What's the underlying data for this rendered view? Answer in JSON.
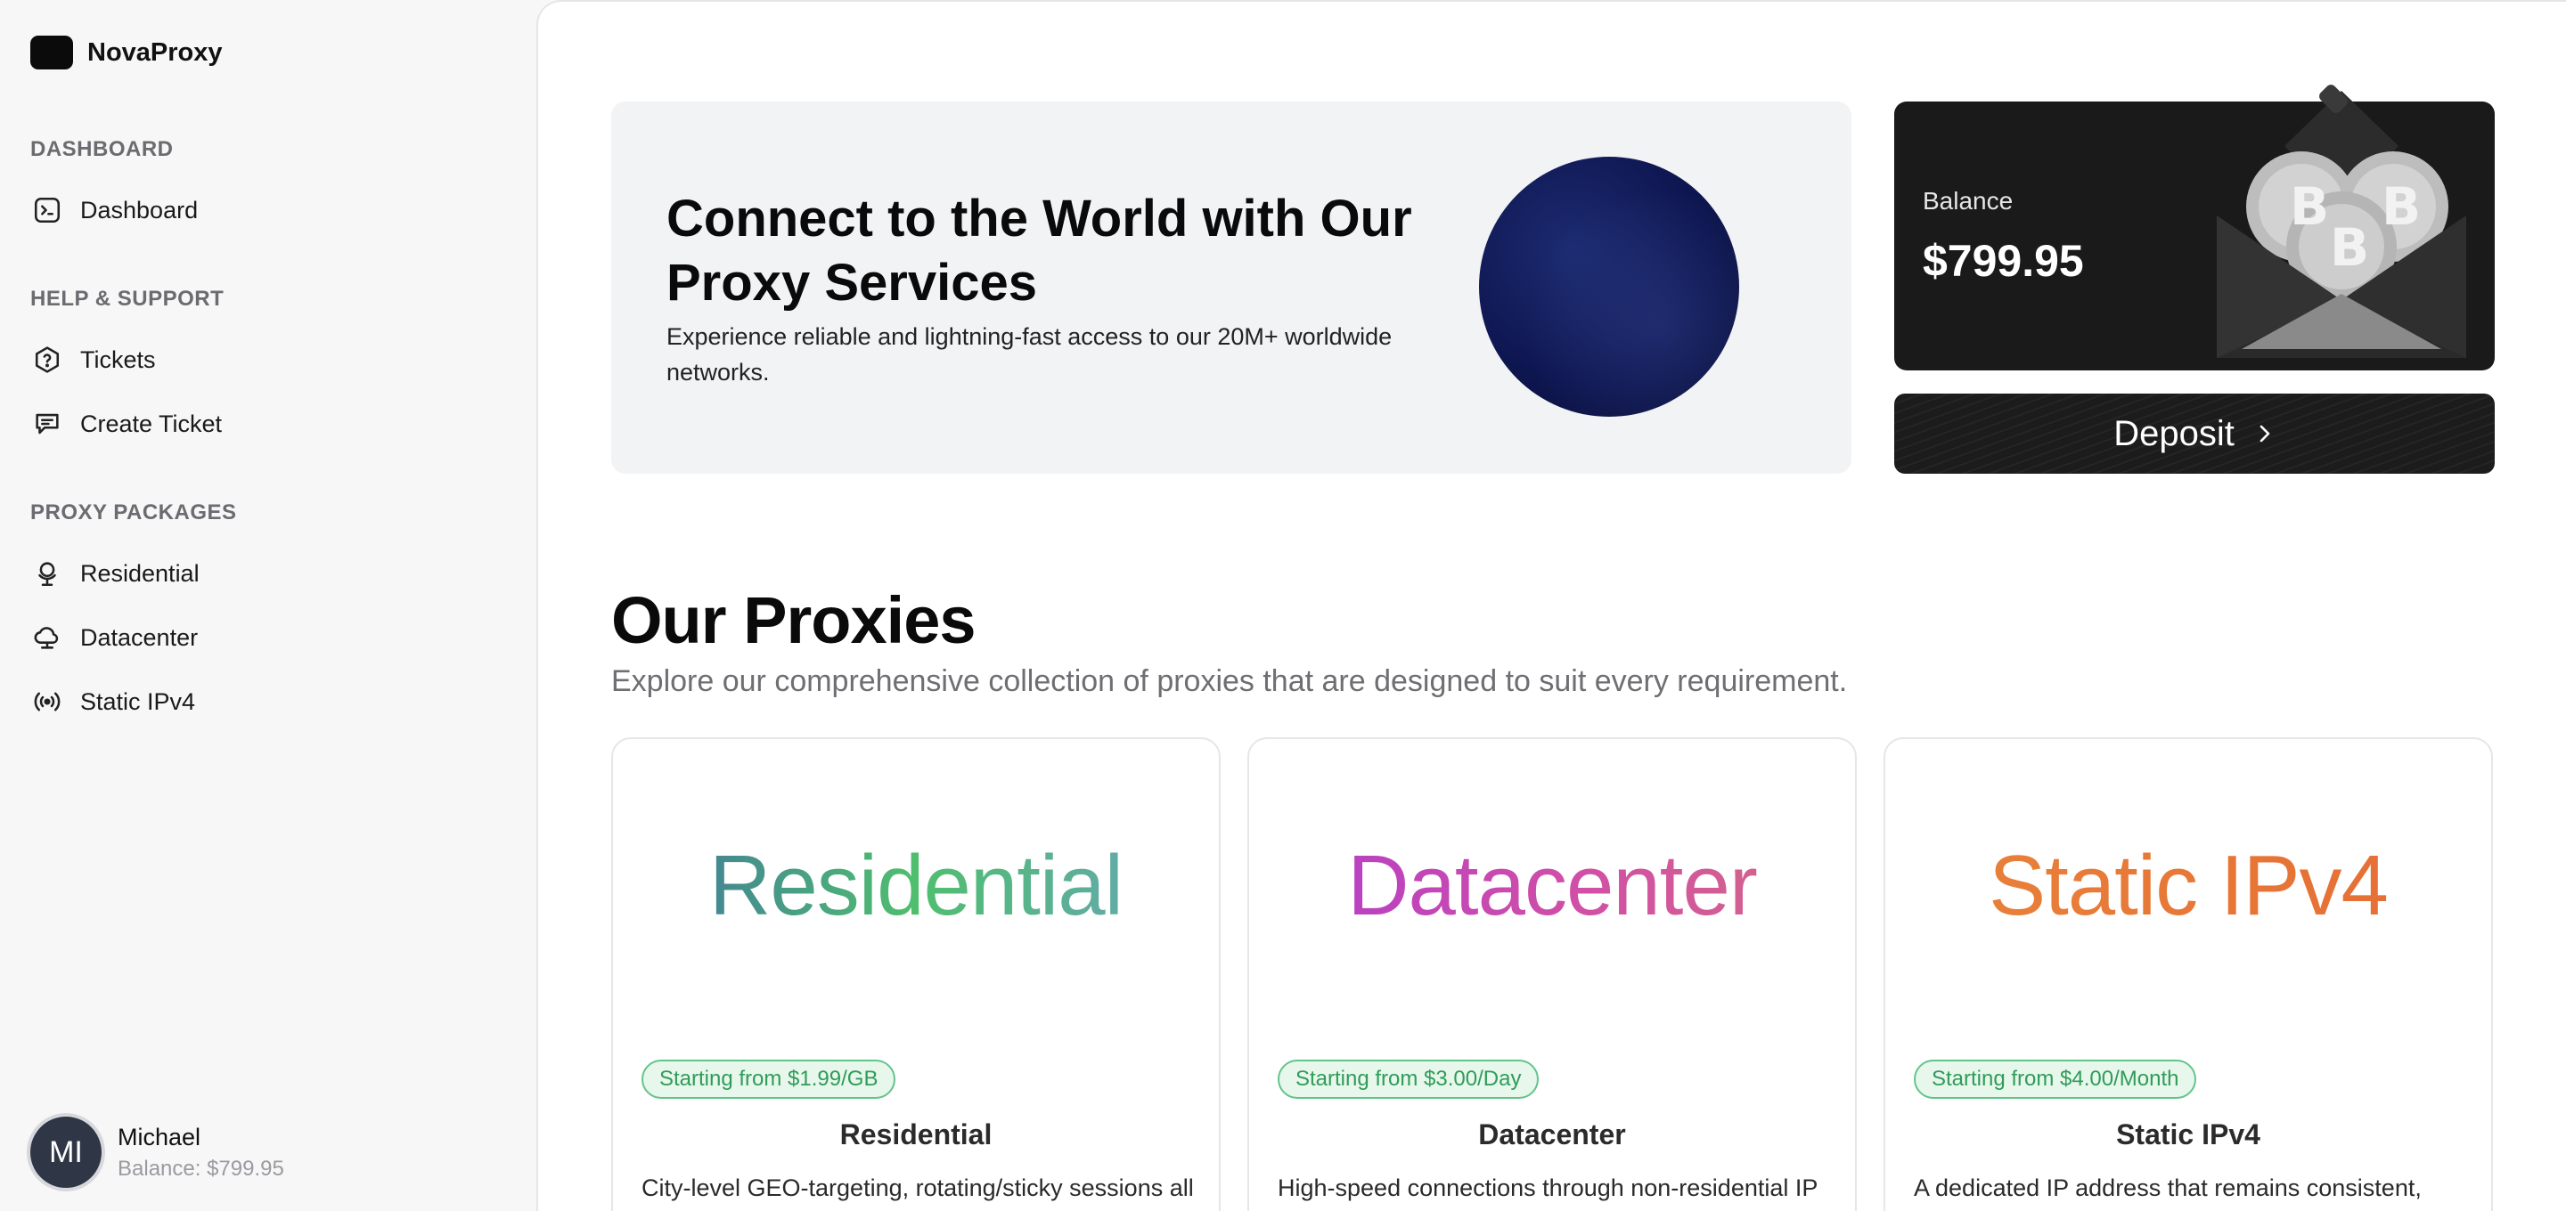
{
  "brand": {
    "name": "NovaProxy"
  },
  "sidebar": {
    "sections": [
      {
        "title": "DASHBOARD",
        "items": [
          {
            "label": "Dashboard",
            "icon": "terminal-icon"
          }
        ]
      },
      {
        "title": "HELP & SUPPORT",
        "items": [
          {
            "label": "Tickets",
            "icon": "hexagon-question-icon"
          },
          {
            "label": "Create Ticket",
            "icon": "message-edit-icon"
          }
        ]
      },
      {
        "title": "PROXY PACKAGES",
        "items": [
          {
            "label": "Residential",
            "icon": "globe-stand-icon"
          },
          {
            "label": "Datacenter",
            "icon": "cloud-server-icon"
          },
          {
            "label": "Static IPv4",
            "icon": "broadcast-icon"
          }
        ]
      }
    ],
    "user": {
      "initials": "MI",
      "name": "Michael",
      "balance": "Balance: $799.95"
    }
  },
  "hero": {
    "title": "Connect to the World with Our Proxy Services",
    "subtitle": "Experience reliable and lightning-fast access to our 20M+ worldwide networks."
  },
  "balance_card": {
    "label": "Balance",
    "amount": "$799.95"
  },
  "deposit": {
    "label": "Deposit"
  },
  "proxies": {
    "heading": "Our Proxies",
    "subtitle": "Explore our comprehensive collection of proxies that are designed to suit every requirement.",
    "cards": [
      {
        "hero": "Residential",
        "badge": "Starting from $1.99/GB",
        "title": "Residential",
        "desc": "City-level GEO-targeting, rotating/sticky sessions all"
      },
      {
        "hero": "Datacenter",
        "badge": "Starting from $3.00/Day",
        "title": "Datacenter",
        "desc": "High-speed connections through non-residential IP"
      },
      {
        "hero": "Static IPv4",
        "badge": "Starting from $4.00/Month",
        "title": "Static IPv4",
        "desc": "A dedicated IP address that remains consistent,"
      }
    ]
  },
  "colors": {
    "accent_dark": "#1a1a1a",
    "badge_green": "#2f9c58",
    "residential_gradient": [
      "#3f6ea3",
      "#4fbf6e",
      "#6aa1bf"
    ],
    "datacenter_gradient": [
      "#b13ccc",
      "#d36a83"
    ],
    "ipv4_gradient": [
      "#e9833a",
      "#e56c34"
    ]
  }
}
